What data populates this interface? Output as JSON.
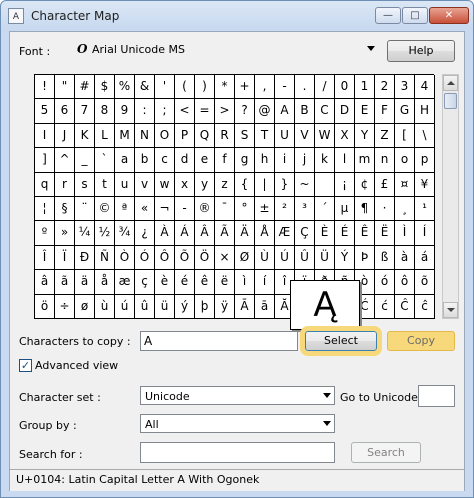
{
  "window": {
    "title": "Character Map",
    "min_glyph": "—",
    "max_glyph": "□",
    "close_glyph": "✕",
    "icon_glyph": "A"
  },
  "font": {
    "label": "Font :",
    "icon_glyph": "O",
    "value": "Arial Unicode MS"
  },
  "help_label": "Help",
  "grid": [
    [
      "!",
      "\"",
      "#",
      "$",
      "%",
      "&",
      "'",
      "(",
      ")",
      "*",
      "+",
      ",",
      "-",
      ".",
      "/",
      "0",
      "1",
      "2",
      "3",
      "4"
    ],
    [
      "5",
      "6",
      "7",
      "8",
      "9",
      ":",
      ";",
      "<",
      "=",
      ">",
      "?",
      "@",
      "A",
      "B",
      "C",
      "D",
      "E",
      "F",
      "G",
      "H"
    ],
    [
      "I",
      "J",
      "K",
      "L",
      "M",
      "N",
      "O",
      "P",
      "Q",
      "R",
      "S",
      "T",
      "U",
      "V",
      "W",
      "X",
      "Y",
      "Z",
      "[",
      "\\"
    ],
    [
      "]",
      "^",
      "_",
      "`",
      "a",
      "b",
      "c",
      "d",
      "e",
      "f",
      "g",
      "h",
      "i",
      "j",
      "k",
      "l",
      "m",
      "n",
      "o",
      "p"
    ],
    [
      "q",
      "r",
      "s",
      "t",
      "u",
      "v",
      "w",
      "x",
      "y",
      "z",
      "{",
      "|",
      "}",
      "~",
      "",
      "¡",
      "¢",
      "£",
      "¤",
      "¥"
    ],
    [
      "¦",
      "§",
      "¨",
      "©",
      "ª",
      "«",
      "¬",
      "-",
      "®",
      "¯",
      "°",
      "±",
      "²",
      "³",
      "´",
      "µ",
      "¶",
      "·",
      "¸",
      "¹"
    ],
    [
      "º",
      "»",
      "¼",
      "½",
      "¾",
      "¿",
      "À",
      "Á",
      "Â",
      "Ã",
      "Ä",
      "Å",
      "Æ",
      "Ç",
      "È",
      "É",
      "Ê",
      "Ë",
      "Ì",
      "Í"
    ],
    [
      "Î",
      "Ï",
      "Ð",
      "Ñ",
      "Ò",
      "Ó",
      "Ô",
      "Õ",
      "Ö",
      "×",
      "Ø",
      "Ù",
      "Ú",
      "Û",
      "Ü",
      "Ý",
      "Þ",
      "ß",
      "à",
      "á"
    ],
    [
      "â",
      "ã",
      "ä",
      "å",
      "æ",
      "ç",
      "è",
      "é",
      "ê",
      "ë",
      "ì",
      "í",
      "î",
      "ï",
      "ð",
      "ñ",
      "ò",
      "ó",
      "ô",
      "õ"
    ],
    [
      "ö",
      "÷",
      "ø",
      "ù",
      "ú",
      "û",
      "ü",
      "ý",
      "þ",
      "ÿ",
      "Ā",
      "ā",
      "Ă",
      "ă",
      "Ą",
      "ą",
      "Ć",
      "ć",
      "Ĉ",
      "ĉ"
    ]
  ],
  "magnified_char": "Ą",
  "copy_label": "Characters to copy :",
  "copy_value": "A",
  "select_label": "Select",
  "copy_button_label": "Copy",
  "advanced_view_label": "Advanced view",
  "check_glyph": "✓",
  "charset_label": "Character set :",
  "charset_value": "Unicode",
  "goto_label": "Go to Unicode :",
  "goto_value": "",
  "groupby_label": "Group by :",
  "groupby_value": "All",
  "search_label": "Search for :",
  "search_value": "",
  "search_button_label": "Search",
  "status_text": "U+0104: Latin Capital Letter A With Ogonek"
}
